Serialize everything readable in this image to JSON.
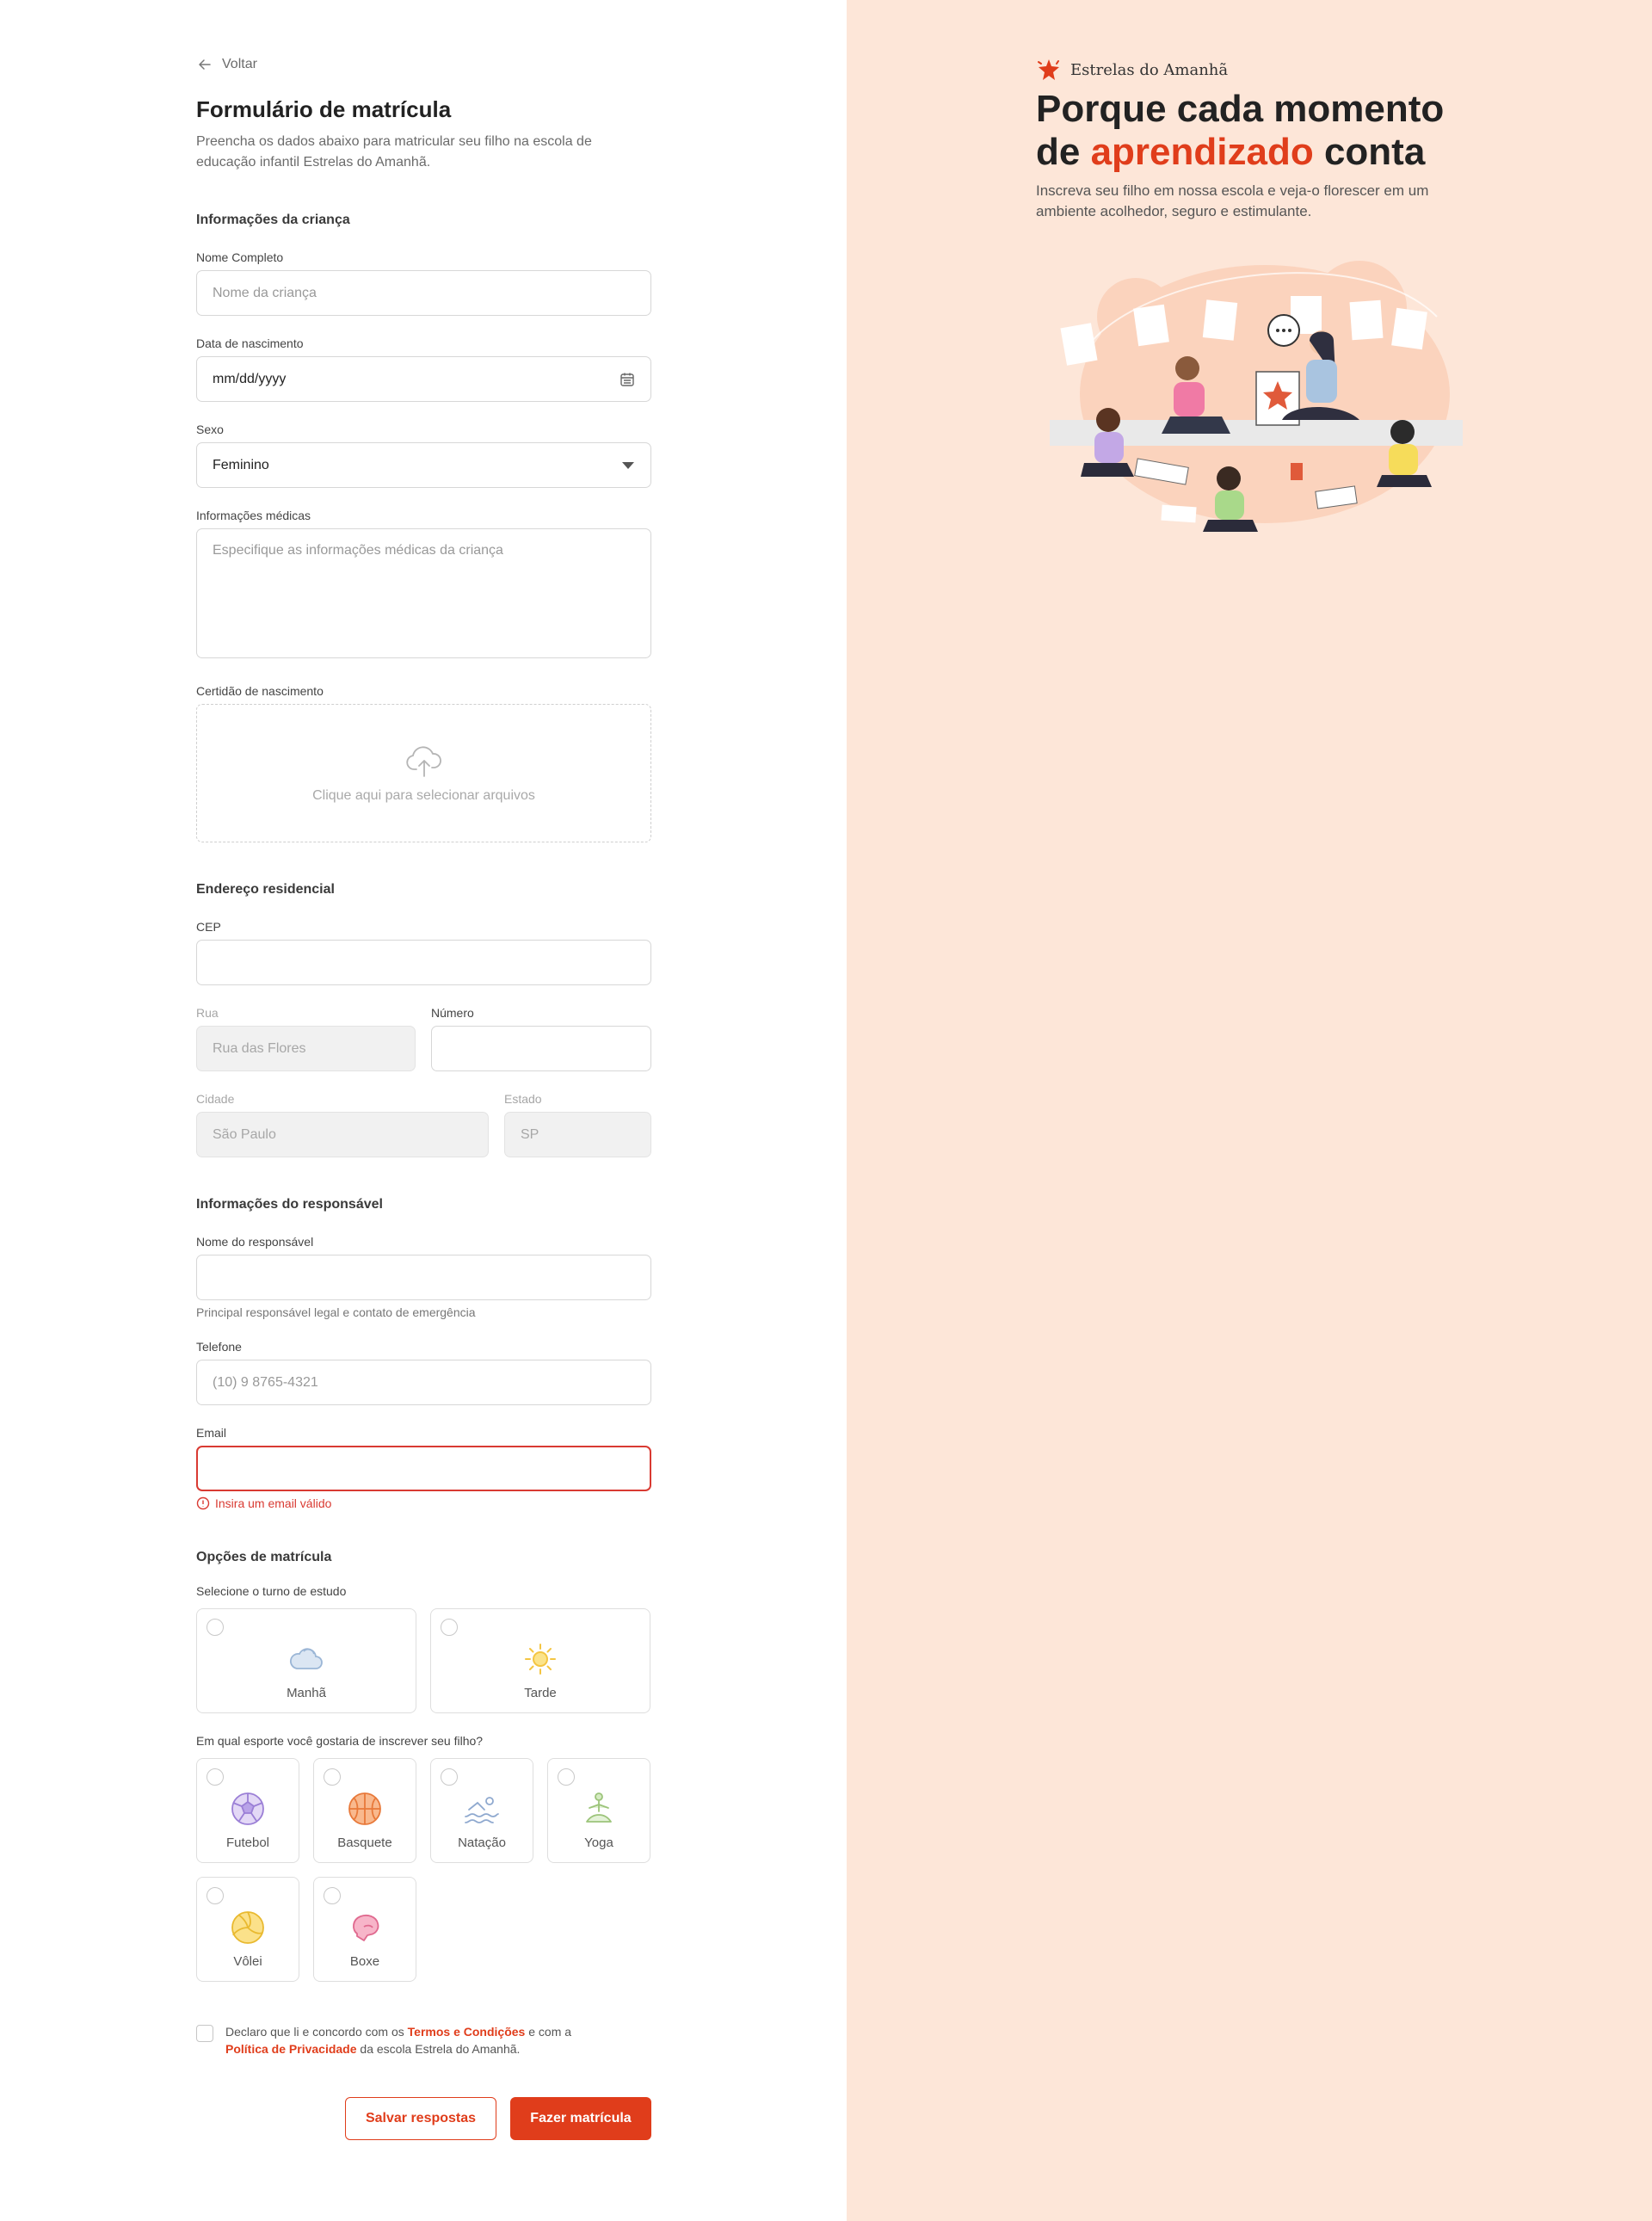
{
  "back": {
    "label": "Voltar"
  },
  "form": {
    "title": "Formulário de matrícula",
    "subtitle": "Preencha os dados abaixo para matricular seu filho na escola de educação infantil Estrelas do Amanhã."
  },
  "child": {
    "section": "Informações da criança",
    "name_label": "Nome Completo",
    "name_placeholder": "Nome da criança",
    "birth_label": "Data de nascimento",
    "birth_value": "mm/dd/yyyy",
    "sex_label": "Sexo",
    "sex_value": "Feminino",
    "medical_label": "Informações médicas",
    "medical_placeholder": "Especifique as informações médicas da criança",
    "certificate_label": "Certidão de nascimento",
    "upload_text": "Clique aqui para selecionar arquivos"
  },
  "address": {
    "section": "Endereço residencial",
    "cep_label": "CEP",
    "street_label": "Rua",
    "street_value": "Rua das Flores",
    "number_label": "Número",
    "city_label": "Cidade",
    "city_value": "São Paulo",
    "state_label": "Estado",
    "state_value": "SP"
  },
  "guardian": {
    "section": "Informações do responsável",
    "name_label": "Nome do responsável",
    "name_hint": "Principal responsável legal e contato de emergência",
    "phone_label": "Telefone",
    "phone_placeholder": "(10) 9 8765-4321",
    "email_label": "Email",
    "email_error": "Insira um email válido"
  },
  "enrollment": {
    "section": "Opções de matrícula",
    "shift_label": "Selecione o turno de estudo",
    "shifts": [
      "Manhã",
      "Tarde"
    ],
    "sport_label": "Em qual esporte você gostaria de inscrever seu filho?",
    "sports": [
      "Futebol",
      "Basquete",
      "Natação",
      "Yoga",
      "Vôlei",
      "Boxe"
    ]
  },
  "terms": {
    "text_1": "Declaro que li e concordo com os ",
    "terms_link": "Termos e Condições",
    "text_2": " e com a ",
    "privacy_link": "Política de Privacidade",
    "text_3": " da escola Estrela do Amanhã."
  },
  "buttons": {
    "save": "Salvar respostas",
    "submit": "Fazer matrícula"
  },
  "hero": {
    "brand": "Estrelas do Amanhã",
    "line_1": "Porque cada momento",
    "line_2_pre": "de ",
    "line_2_accent": "aprendizado",
    "line_2_post": " conta",
    "subtitle": "Inscreva seu filho em nossa escola e veja-o florescer em um ambiente acolhedor, seguro e estimulante."
  },
  "colors": {
    "accent": "#e03d1b",
    "panel": "#fde6d8",
    "error": "#d93a32"
  },
  "icons": {
    "back": "arrow-left-icon",
    "calendar": "calendar-icon",
    "dropdown": "caret-down-icon",
    "upload": "cloud-upload-icon",
    "error": "alert-circle-icon",
    "shifts": [
      "cloud-icon",
      "sun-icon"
    ],
    "sports": [
      "soccer-ball-icon",
      "basketball-icon",
      "swimmer-icon",
      "yoga-icon",
      "volleyball-icon",
      "boxing-glove-icon"
    ],
    "brand": "star-logo-icon"
  }
}
